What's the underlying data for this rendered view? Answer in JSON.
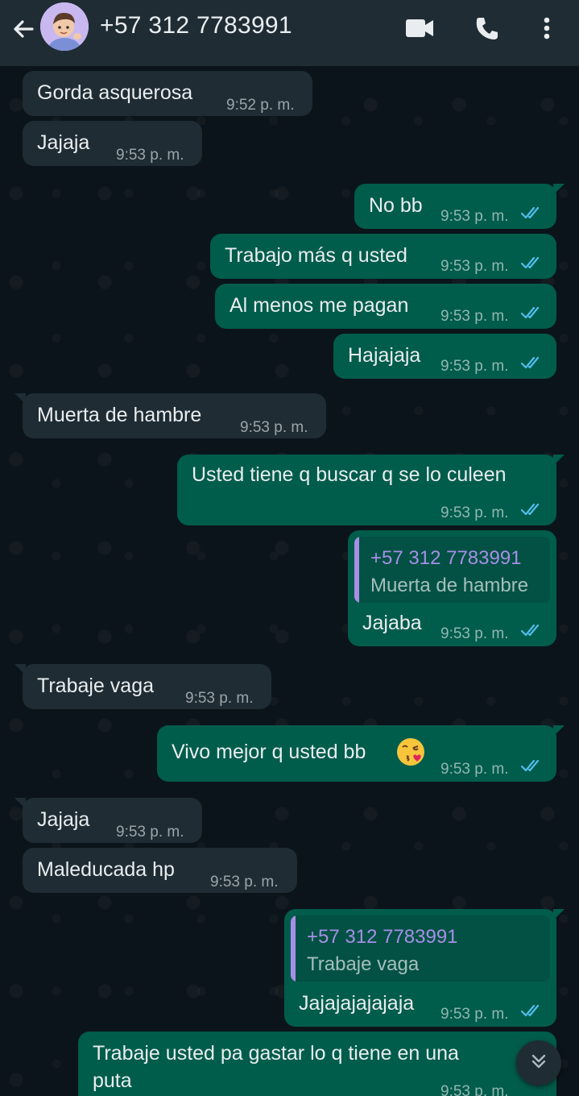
{
  "header": {
    "contact": "+57 312 7783991"
  },
  "messages": [
    {
      "dir": "in",
      "text": "Gorda asquerosa",
      "time": "9:52 p. m."
    },
    {
      "dir": "in",
      "text": "Jajaja",
      "time": "9:53 p. m."
    },
    {
      "dir": "out",
      "text": "No bb",
      "time": "9:53 p. m."
    },
    {
      "dir": "out",
      "text": "Trabajo más q usted",
      "time": "9:53 p. m."
    },
    {
      "dir": "out",
      "text": "Al menos me pagan",
      "time": "9:53 p. m."
    },
    {
      "dir": "out",
      "text": "Hajajaja",
      "time": "9:53 p. m."
    },
    {
      "dir": "in",
      "text": "Muerta de hambre",
      "time": "9:53 p. m."
    },
    {
      "dir": "out",
      "text": "Usted tiene q buscar q se lo culeen",
      "time": "9:53 p. m."
    },
    {
      "dir": "out",
      "quote_name": "+57 312 7783991",
      "quote_text": "Muerta de hambre",
      "text": "Jajaba",
      "time": "9:53 p. m."
    },
    {
      "dir": "in",
      "text": "Trabaje vaga",
      "time": "9:53 p. m."
    },
    {
      "dir": "out",
      "text": "Vivo mejor q usted bb",
      "emoji": "kissing-face-emoji",
      "time": "9:53 p. m."
    },
    {
      "dir": "in",
      "text": "Jajaja",
      "time": "9:53 p. m."
    },
    {
      "dir": "in",
      "text": "Maleducada hp",
      "time": "9:53 p. m."
    },
    {
      "dir": "out",
      "quote_name": "+57 312 7783991",
      "quote_text": "Trabaje vaga",
      "text": "Jajajajajajaja",
      "time": "9:53 p. m."
    },
    {
      "dir": "out",
      "text_line1": "Trabaje usted pa gastar lo q tiene en una",
      "text_line2": "puta",
      "time": "9:53 p. m."
    }
  ],
  "colors": {
    "header_bg": "#1f2c34",
    "incoming_bubble": "#1f2c34",
    "outgoing_bubble": "#005c4b",
    "read_ticks": "#53bdeb",
    "quote_name": "#a68fe6"
  },
  "icons": [
    "back-arrow-icon",
    "video-call-icon",
    "phone-icon",
    "more-options-icon",
    "double-check-icon",
    "scroll-down-icon"
  ]
}
